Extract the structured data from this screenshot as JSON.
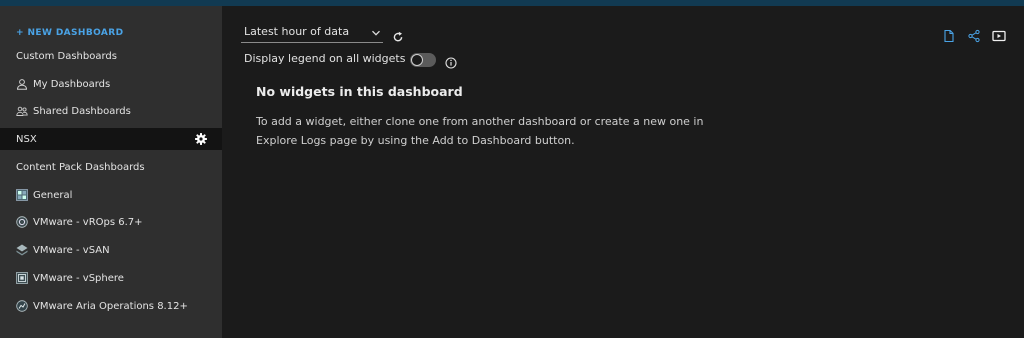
{
  "sidebar": {
    "new_dashboard": "+ NEW DASHBOARD",
    "custom_header": "Custom Dashboards",
    "my_dashboards": "My Dashboards",
    "shared_dashboards": "Shared Dashboards",
    "active_item": "NSX",
    "content_pack_header": "Content Pack Dashboards",
    "packs": [
      {
        "label": "General",
        "icon": "grid-icon"
      },
      {
        "label": "VMware - vROps 6.7+",
        "icon": "vrops-icon"
      },
      {
        "label": "VMware - vSAN",
        "icon": "vsan-icon"
      },
      {
        "label": "VMware - vSphere",
        "icon": "vsphere-icon"
      },
      {
        "label": "VMware Aria Operations 8.12+",
        "icon": "aria-ops-icon"
      }
    ]
  },
  "toolbar": {
    "time_range": "Latest hour of data",
    "legend_label": "Display legend on all widgets",
    "legend_toggle_on": false
  },
  "empty_state": {
    "title": "No widgets in this dashboard",
    "message": "To add a widget, either clone one from another dashboard or create a new one in Explore Logs page by using the Add to Dashboard button."
  },
  "colors": {
    "accent": "#4aa3e6",
    "sidebar_bg": "#2f2f2f",
    "main_bg": "#1b1b1b",
    "active_bg": "#131313",
    "topbar": "#113a52"
  }
}
